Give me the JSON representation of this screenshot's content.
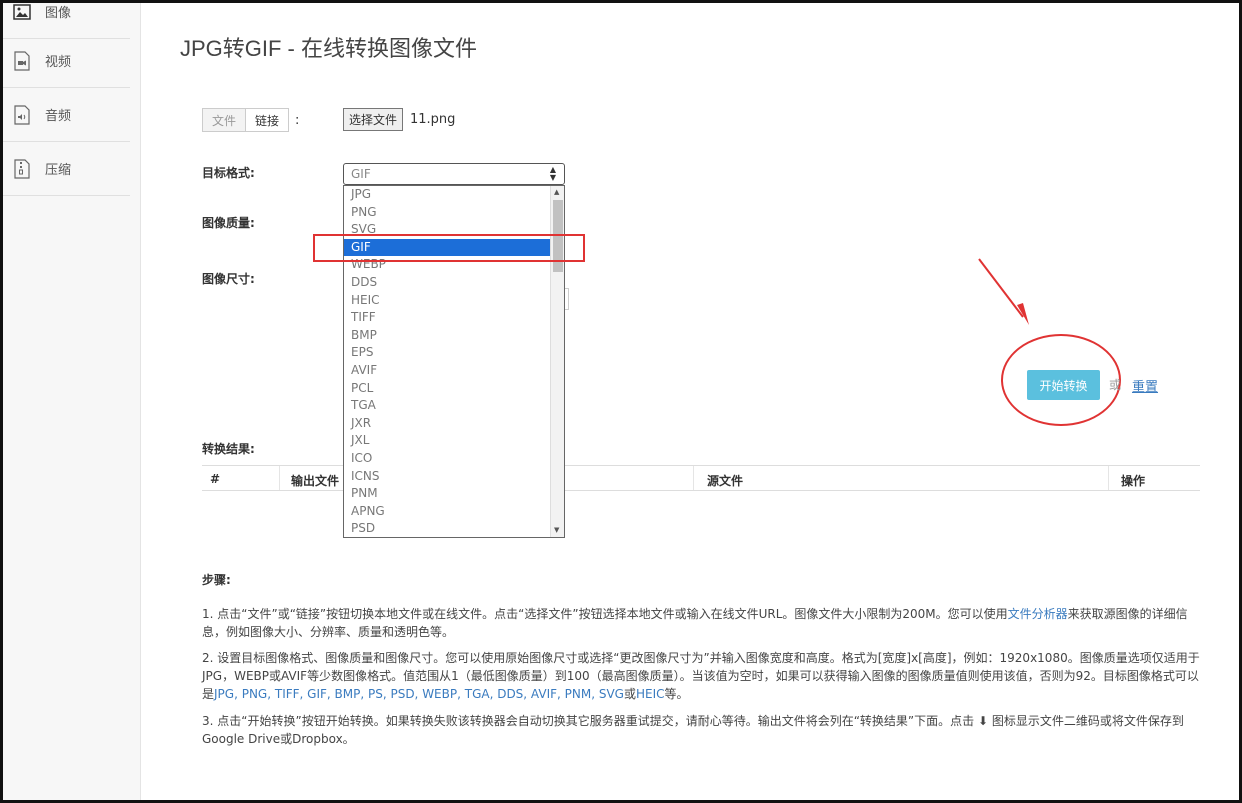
{
  "sidebar": {
    "items": [
      {
        "label": "图像",
        "icon": "image-icon"
      },
      {
        "label": "视频",
        "icon": "video-icon"
      },
      {
        "label": "音频",
        "icon": "audio-icon"
      },
      {
        "label": "压缩",
        "icon": "archive-icon"
      }
    ]
  },
  "page": {
    "title": "JPG转GIF - 在线转换图像文件"
  },
  "source": {
    "tabs": [
      "文件",
      "链接"
    ],
    "colon": ":",
    "choose_button": "选择文件",
    "file_name": "11.png"
  },
  "form": {
    "target_format_label": "目标格式:",
    "quality_label": "图像质量:",
    "size_label": "图像尺寸:",
    "format_selected": "GIF",
    "format_options": [
      "JPG",
      "PNG",
      "SVG",
      "GIF",
      "WEBP",
      "DDS",
      "HEIC",
      "TIFF",
      "BMP",
      "EPS",
      "AVIF",
      "PCL",
      "TGA",
      "JXR",
      "JXL",
      "ICO",
      "ICNS",
      "PNM",
      "APNG",
      "PSD"
    ]
  },
  "actions": {
    "convert_label": "开始转换",
    "or_label": "或",
    "reset_label": "重置"
  },
  "results": {
    "label": "转换结果:",
    "columns": [
      "#",
      "输出文件",
      "源文件",
      "操作"
    ]
  },
  "steps": {
    "title": "步骤:",
    "step1_a": "1. 点击“文件”或“链接”按钮切换本地文件或在线文件。点击“选择文件”按钮选择本地文件或输入在线文件URL。图像文件大小限制为200M。您可以使用",
    "step1_link": "文件分析器",
    "step1_b": "来获取源图像的详细信息，例如图像大小、分辨率、质量和透明色等。",
    "step2_a": "2. 设置目标图像格式、图像质量和图像尺寸。您可以使用原始图像尺寸或选择“更改图像尺寸为”并输入图像宽度和高度。格式为[宽度]x[高度]，例如：1920x1080。图像质量选项仅适用于JPG，WEBP或AVIF等少数图像格式。值范围从1（最低图像质量）到100（最高图像质量）。当该值为空时，如果可以获得输入图像的图像质量值则使用该值，否则为92。目标图像格式可以是",
    "step2_formats": "JPG, PNG, TIFF, GIF, BMP, PS, PSD, WEBP, TGA, DDS, AVIF, PNM, SVG",
    "step2_or": "或",
    "step2_heic": "HEIC",
    "step2_end": "等。",
    "step3": "3. 点击“开始转换”按钮开始转换。如果转换失败该转换器会自动切换其它服务器重试提交，请耐心等待。输出文件将会列在“转换结果”下面。点击 ⬇ 图标显示文件二维码或将文件保存到Google Drive或Dropbox。"
  },
  "colors": {
    "accent": "#5bc0de",
    "selected_option": "#1c6ed8",
    "annotation_red": "#e03333",
    "link": "#3a7bbf"
  }
}
